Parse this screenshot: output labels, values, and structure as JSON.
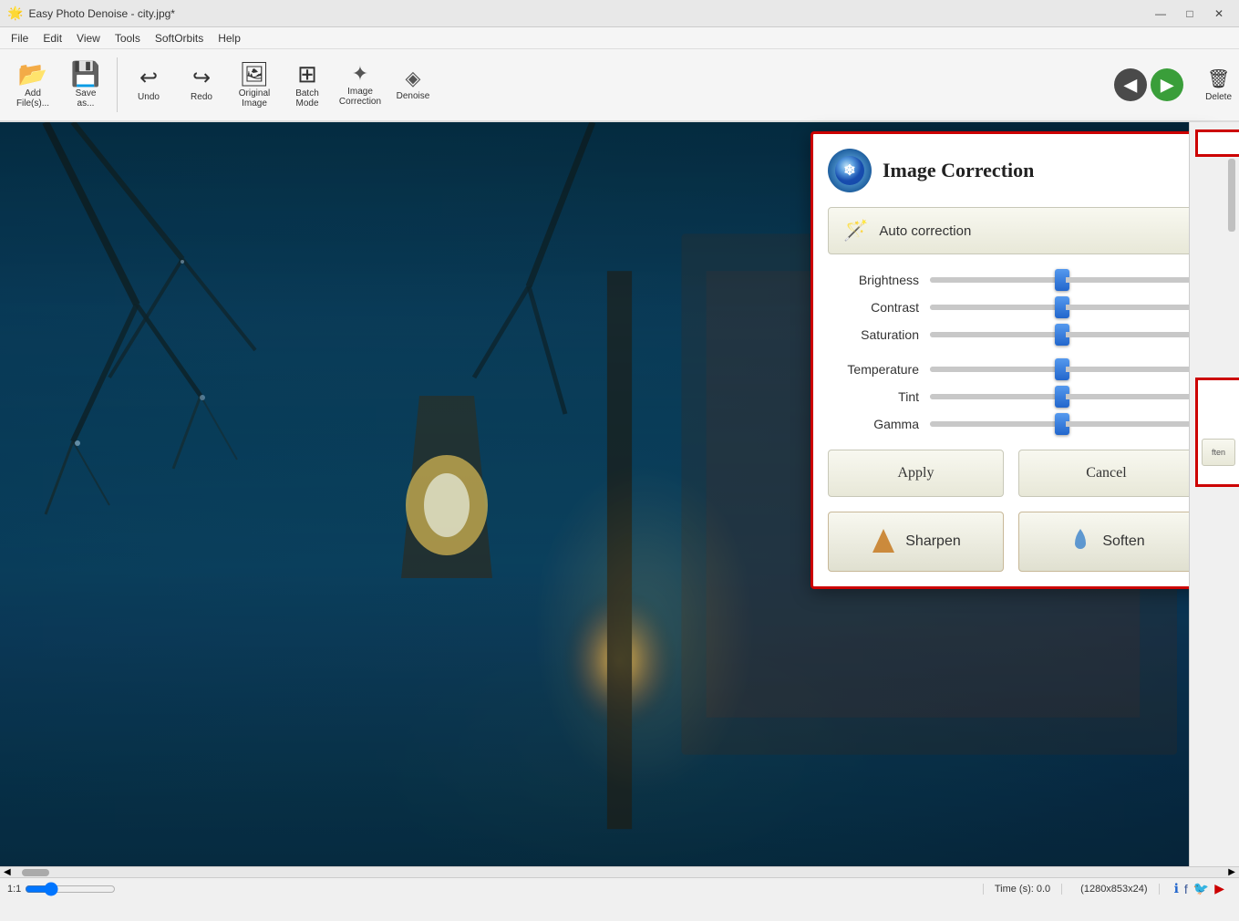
{
  "window": {
    "title": "Easy Photo Denoise - city.jpg*",
    "icon": "🌟"
  },
  "titlebar": {
    "minimize": "—",
    "maximize": "□",
    "close": "✕"
  },
  "menu": {
    "items": [
      "File",
      "Edit",
      "View",
      "Tools",
      "SoftOrbits",
      "Help"
    ]
  },
  "toolbar": {
    "buttons": [
      {
        "id": "add-files",
        "icon": "📂",
        "label": "Add\nFile(s)..."
      },
      {
        "id": "save-as",
        "icon": "💾",
        "label": "Save\nas..."
      },
      {
        "id": "undo",
        "icon": "↩",
        "label": "Undo"
      },
      {
        "id": "redo",
        "icon": "↪",
        "label": "Redo"
      },
      {
        "id": "original-image",
        "icon": "🖼",
        "label": "Original\nImage"
      },
      {
        "id": "batch-mode",
        "icon": "⊞",
        "label": "Batch\nMode"
      },
      {
        "id": "image-correction",
        "icon": "✦",
        "label": "Image\nCorrection"
      },
      {
        "id": "denoise",
        "icon": "◈",
        "label": "Denoise"
      }
    ],
    "nav_prev": "◀",
    "nav_next": "▶",
    "delete_label": "Delete"
  },
  "image_correction_panel": {
    "title": "Image Correction",
    "logo_symbol": "❄",
    "auto_correction_label": "Auto correction",
    "wand_symbol": "✦",
    "sliders": [
      {
        "id": "brightness",
        "label": "Brightness",
        "value": 50,
        "position": 50
      },
      {
        "id": "contrast",
        "label": "Contrast",
        "value": 50,
        "position": 50
      },
      {
        "id": "saturation",
        "label": "Saturation",
        "value": 50,
        "position": 50
      },
      {
        "id": "temperature",
        "label": "Temperature",
        "value": 50,
        "position": 50
      },
      {
        "id": "tint",
        "label": "Tint",
        "value": 50,
        "position": 50
      },
      {
        "id": "gamma",
        "label": "Gamma",
        "value": 50,
        "position": 50
      }
    ],
    "apply_label": "Apply",
    "cancel_label": "Cancel",
    "sharpen_label": "Sharpen",
    "soften_label": "Soften"
  },
  "statusbar": {
    "zoom_level": "1:1",
    "time_label": "Time (s):",
    "time_value": "0.0",
    "dimensions": "(1280x853x24)",
    "scroll_left": "◀",
    "scroll_right": "▶"
  }
}
